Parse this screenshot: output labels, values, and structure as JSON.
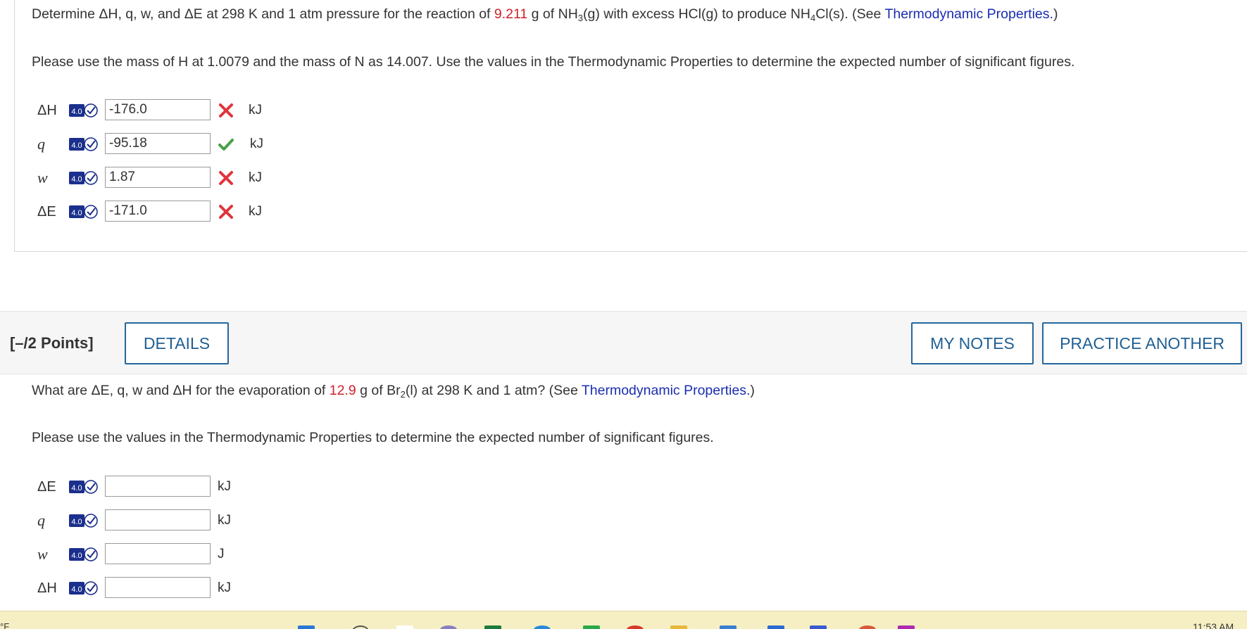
{
  "q1": {
    "prompt": {
      "t1": "Determine ΔH, q, w, and ΔE at 298 K and 1 atm pressure for the reaction of ",
      "mass": "9.211",
      "t2": " g of NH",
      "sub1": "3",
      "t3": "(g) with excess HCl(g) to produce NH",
      "sub2": "4",
      "t4": "Cl(s). (See ",
      "link": "Thermodynamic Properties.",
      "t5": ")"
    },
    "note": "Please use the mass of H at 1.0079 and the mass of N as 14.007. Use the values in the Thermodynamic Properties to determine the expected number of significant figures.",
    "rows": [
      {
        "symbol": "ΔH",
        "value": "-176.0",
        "status": "incorrect",
        "unit": "kJ"
      },
      {
        "symbol": "q",
        "value": "-95.18",
        "status": "correct",
        "unit": "kJ"
      },
      {
        "symbol": "w",
        "value": "1.87",
        "status": "incorrect",
        "unit": "kJ"
      },
      {
        "symbol": "ΔE",
        "value": "-171.0",
        "status": "incorrect",
        "unit": "kJ"
      }
    ]
  },
  "q2": {
    "points": "[–/2 Points]",
    "details_label": "DETAILS",
    "my_notes_label": "MY NOTES",
    "practice_label": "PRACTICE ANOTHER",
    "prompt": {
      "t1": "What are ΔE, q, w and ΔH for the evaporation of ",
      "mass": "12.9",
      "t2": " g of Br",
      "sub1": "2",
      "t3": "(l) at 298 K and 1 atm? (See ",
      "link": "Thermodynamic Properties.",
      "t4": ")"
    },
    "note": "Please use the values in the Thermodynamic Properties to determine the expected number of significant figures.",
    "rows": [
      {
        "symbol": "ΔE",
        "value": "",
        "unit": "kJ"
      },
      {
        "symbol": "q",
        "value": "",
        "unit": "kJ"
      },
      {
        "symbol": "w",
        "value": "",
        "unit": "J"
      },
      {
        "symbol": "ΔH",
        "value": "",
        "unit": "kJ"
      }
    ]
  },
  "badge_label": "4.0",
  "taskbar": {
    "temp": "°F",
    "time": "11:53 AM"
  },
  "colors": {
    "accent": "#1f5f93",
    "highlight": "#d0202b",
    "link": "#1a2db0",
    "incorrect": "#e0343c",
    "correct": "#4aa04a",
    "badge": "#1b2f8c"
  }
}
